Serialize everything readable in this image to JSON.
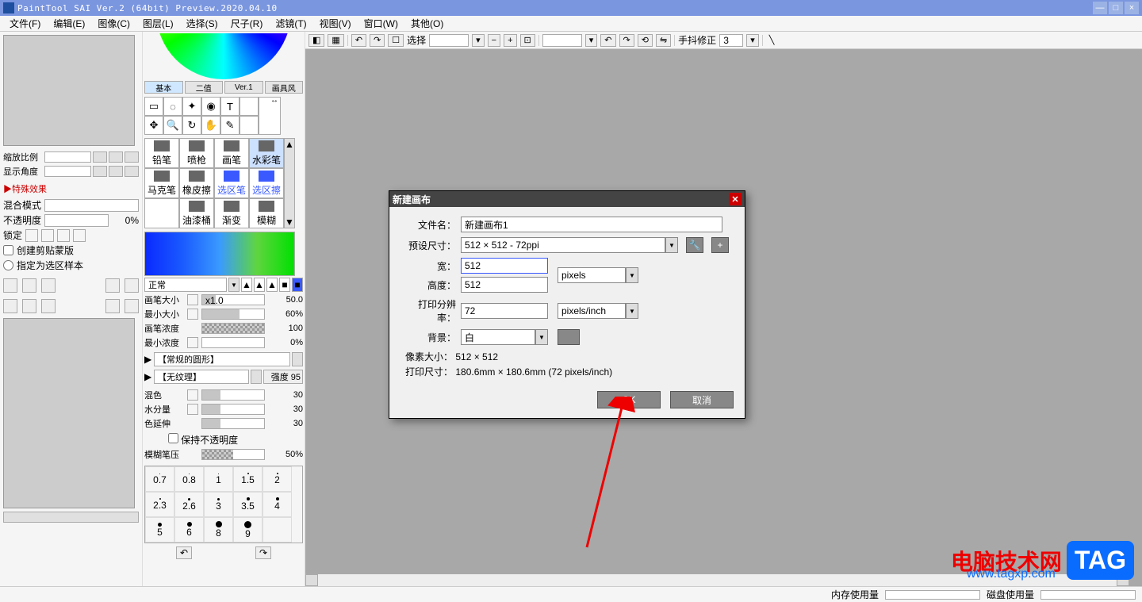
{
  "title": "PaintTool SAI Ver.2 (64bit) Preview.2020.04.10",
  "menu": [
    "文件(F)",
    "编辑(E)",
    "图像(C)",
    "图层(L)",
    "选择(S)",
    "尺子(R)",
    "滤镜(T)",
    "视图(V)",
    "窗口(W)",
    "其他(O)"
  ],
  "left": {
    "zoom_label": "缩放比例",
    "angle_label": "显示角度",
    "fx_header": "▶特殊效果",
    "blend_label": "混合模式",
    "opacity_label": "不透明度",
    "opacity_pct": "0%",
    "lock_label": "锁定",
    "clip_label": "创建剪贴蒙版",
    "sel_label": "指定为选区样本"
  },
  "mid": {
    "tabs": [
      "基本",
      "二值",
      "Ver.1",
      "画具风"
    ],
    "brushes": [
      "铅笔",
      "喷枪",
      "画笔",
      "水彩笔",
      "马克笔",
      "橡皮擦",
      "选区笔",
      "选区擦",
      "",
      "油漆桶",
      "渐变",
      "模糊"
    ],
    "selected_brush_index": 3,
    "mode": "正常",
    "size_label": "画笔大小",
    "size_mult": "x1.0",
    "size_val": "50.0",
    "min_size_label": "最小大小",
    "min_size_val": "60%",
    "density_label": "画笔浓度",
    "density_val": "100",
    "min_density_label": "最小浓度",
    "min_density_val": "0%",
    "shape_combo": "【常规的圆形】",
    "tex_combo": "【无纹理】",
    "tex_extra": "强度   95",
    "mix_label": "混色",
    "mix_val": "30",
    "water_label": "水分量",
    "water_val": "30",
    "spread_label": "色延伸",
    "spread_val": "30",
    "keep_opacity": "保持不透明度",
    "blur_label": "模糊笔压",
    "blur_val": "50%",
    "dots": [
      "0.7",
      "0.8",
      "1",
      "1.5",
      "2",
      "2.3",
      "2.6",
      "3",
      "3.5",
      "4",
      "5",
      "6",
      "8",
      "9",
      ""
    ]
  },
  "toolbar": {
    "select": "选择",
    "stab": "手抖修正",
    "stab_val": "3"
  },
  "dialog": {
    "title": "新建画布",
    "filename_label": "文件名：",
    "filename": "新建画布1",
    "preset_label": "预设尺寸：",
    "preset": "512 × 512 - 72ppi",
    "width_label": "宽：",
    "width": "512",
    "height_label": "高度：",
    "height": "512",
    "unit1": "pixels",
    "res_label": "打印分辨率：",
    "res": "72",
    "res_unit": "pixels/inch",
    "bg_label": "背景：",
    "bg": "白",
    "info1_label": "像素大小：",
    "info1": "512 × 512",
    "info2_label": "打印尺寸：",
    "info2": "180.6mm × 180.6mm (72 pixels/inch)",
    "ok": "OK",
    "cancel": "取消"
  },
  "status": {
    "mem": "内存使用量",
    "disk": "磁盘使用量"
  },
  "watermark": {
    "text": "电脑技术网",
    "tag": "TAG",
    "url": "www.tagxp.com"
  }
}
